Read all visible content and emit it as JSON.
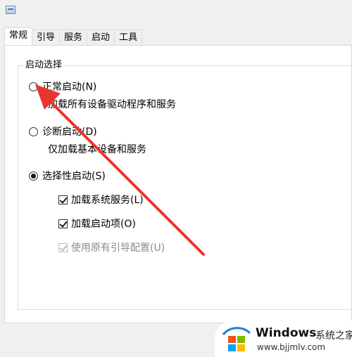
{
  "tabs": [
    {
      "label": "常规",
      "active": true
    },
    {
      "label": "引导",
      "active": false
    },
    {
      "label": "服务",
      "active": false
    },
    {
      "label": "启动",
      "active": false
    },
    {
      "label": "工具",
      "active": false
    }
  ],
  "startup_group": {
    "title": "启动选择",
    "normal": {
      "label": "正常启动(N)",
      "desc": "加载所有设备驱动程序和服务",
      "checked": false
    },
    "diagnostic": {
      "label": "诊断启动(D)",
      "desc": "仅加载基本设备和服务",
      "checked": false
    },
    "selective": {
      "label": "选择性启动(S)",
      "checked": true,
      "load_services": {
        "label": "加载系统服务(L)",
        "checked": true
      },
      "load_startup": {
        "label": "加载启动项(O)",
        "checked": true
      },
      "use_original": {
        "label": "使用原有引导配置(U)",
        "checked": true,
        "disabled": true
      }
    }
  },
  "annotation": {
    "color": "#e8352e",
    "icon": "red-arrow-icon"
  },
  "watermark": {
    "brand": "Windows",
    "cn": "系统之家",
    "url": "www.bjjmlv.com",
    "logo_colors": [
      "#f25022",
      "#7fba00",
      "#00a4ef",
      "#ffb900"
    ],
    "swoosh_color": "#1c7fd6"
  }
}
